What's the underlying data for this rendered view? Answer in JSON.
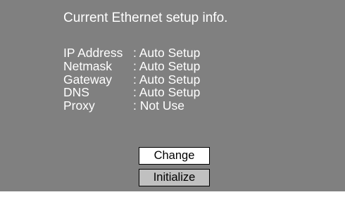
{
  "title": "Current Ethernet setup info.",
  "info_rows": [
    {
      "label": "IP Address",
      "value": ": Auto Setup"
    },
    {
      "label": "Netmask",
      "value": ": Auto Setup"
    },
    {
      "label": "Gateway",
      "value": ": Auto Setup"
    },
    {
      "label": "DNS",
      "value": ": Auto Setup"
    },
    {
      "label": "Proxy",
      "value": ": Not Use"
    }
  ],
  "buttons": {
    "change_label": "Change",
    "initialize_label": "Initialize"
  },
  "colors": {
    "panel_background": "#808080",
    "text": "#ffffff",
    "button_default": "#ffffff",
    "button_selected": "#c0c0c0"
  }
}
